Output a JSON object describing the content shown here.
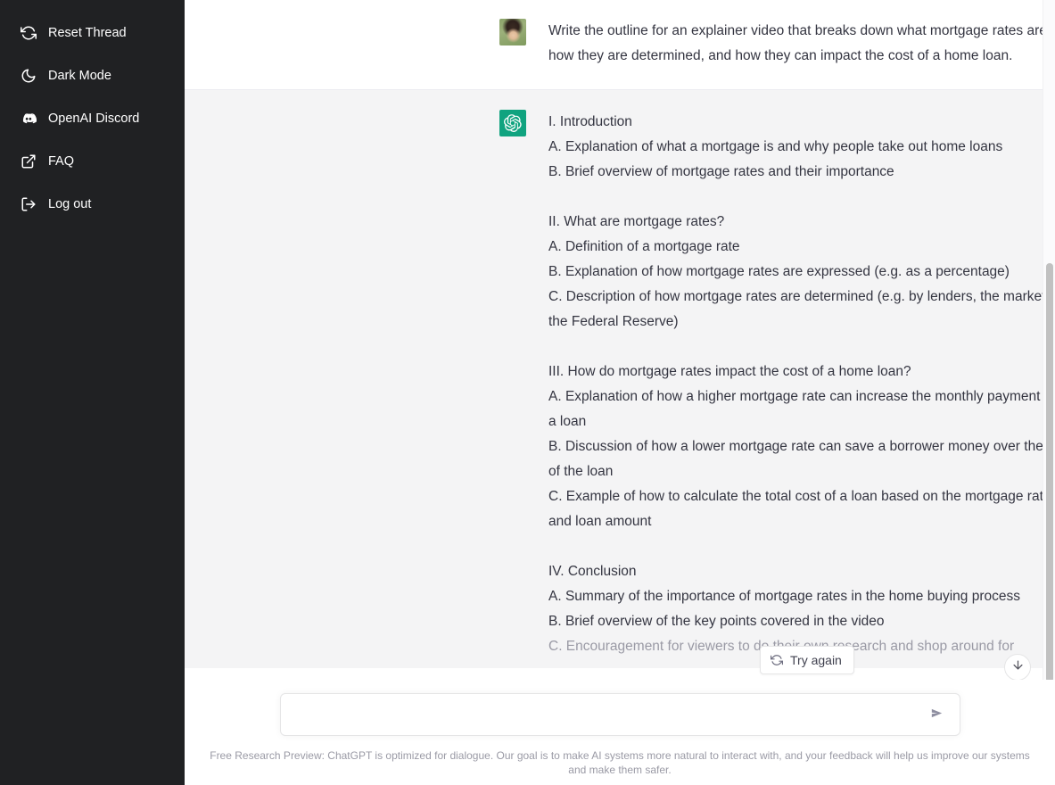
{
  "sidebar": {
    "items": [
      {
        "label": "Reset Thread",
        "icon": "refresh-icon"
      },
      {
        "label": "Dark Mode",
        "icon": "moon-icon"
      },
      {
        "label": "OpenAI Discord",
        "icon": "discord-icon"
      },
      {
        "label": "FAQ",
        "icon": "external-link-icon"
      },
      {
        "label": "Log out",
        "icon": "logout-icon"
      }
    ],
    "background_color": "#202123",
    "text_color": "#ffffff"
  },
  "conversation": {
    "user_message": {
      "text": "Write the outline for an explainer video that breaks down what mortgage rates are, how they are determined, and how they can impact the cost of a home loan.",
      "avatar": "user-photo-avatar",
      "edit_icon": "edit-pencil-icon"
    },
    "assistant_message": {
      "avatar": "chatgpt-logo-icon",
      "avatar_color": "#10a37f",
      "lines": [
        {
          "text": "I. Introduction",
          "faded": false
        },
        {
          "text": "A. Explanation of what a mortgage is and why people take out home loans",
          "faded": false
        },
        {
          "text": "B. Brief overview of mortgage rates and their importance",
          "faded": false
        },
        {
          "text": "",
          "faded": false
        },
        {
          "text": "II. What are mortgage rates?",
          "faded": false
        },
        {
          "text": "A. Definition of a mortgage rate",
          "faded": false
        },
        {
          "text": "B. Explanation of how mortgage rates are expressed (e.g. as a percentage)",
          "faded": false
        },
        {
          "text": "C. Description of how mortgage rates are determined (e.g. by lenders, the market, the Federal Reserve)",
          "faded": false
        },
        {
          "text": "",
          "faded": false
        },
        {
          "text": "III. How do mortgage rates impact the cost of a home loan?",
          "faded": false
        },
        {
          "text": "A. Explanation of how a higher mortgage rate can increase the monthly payment on a loan",
          "faded": false
        },
        {
          "text": "B. Discussion of how a lower mortgage rate can save a borrower money over the life of the loan",
          "faded": false
        },
        {
          "text": "C. Example of how to calculate the total cost of a loan based on the mortgage rate and loan amount",
          "faded": false
        },
        {
          "text": "",
          "faded": false
        },
        {
          "text": "IV. Conclusion",
          "faded": false
        },
        {
          "text": "A. Summary of the importance of mortgage rates in the home buying process",
          "faded": false
        },
        {
          "text": "B. Brief overview of the key points covered in the video",
          "faded": false
        },
        {
          "text": "C. Encouragement for viewers to do their own research and shop around for",
          "faded": true
        }
      ],
      "thumbs_up_icon": "thumbs-up-icon",
      "thumbs_down_icon": "thumbs-down-icon"
    }
  },
  "try_again": {
    "label": "Try again",
    "icon": "refresh-icon"
  },
  "scroll_to_bottom": {
    "icon": "arrow-down-icon"
  },
  "composer": {
    "value": "",
    "placeholder": "",
    "send_icon": "send-arrow-icon"
  },
  "footer": {
    "note": "Free Research Preview: ChatGPT is optimized for dialogue. Our goal is to make AI systems more natural to interact with, and your feedback will help us improve our systems and make them safer."
  }
}
